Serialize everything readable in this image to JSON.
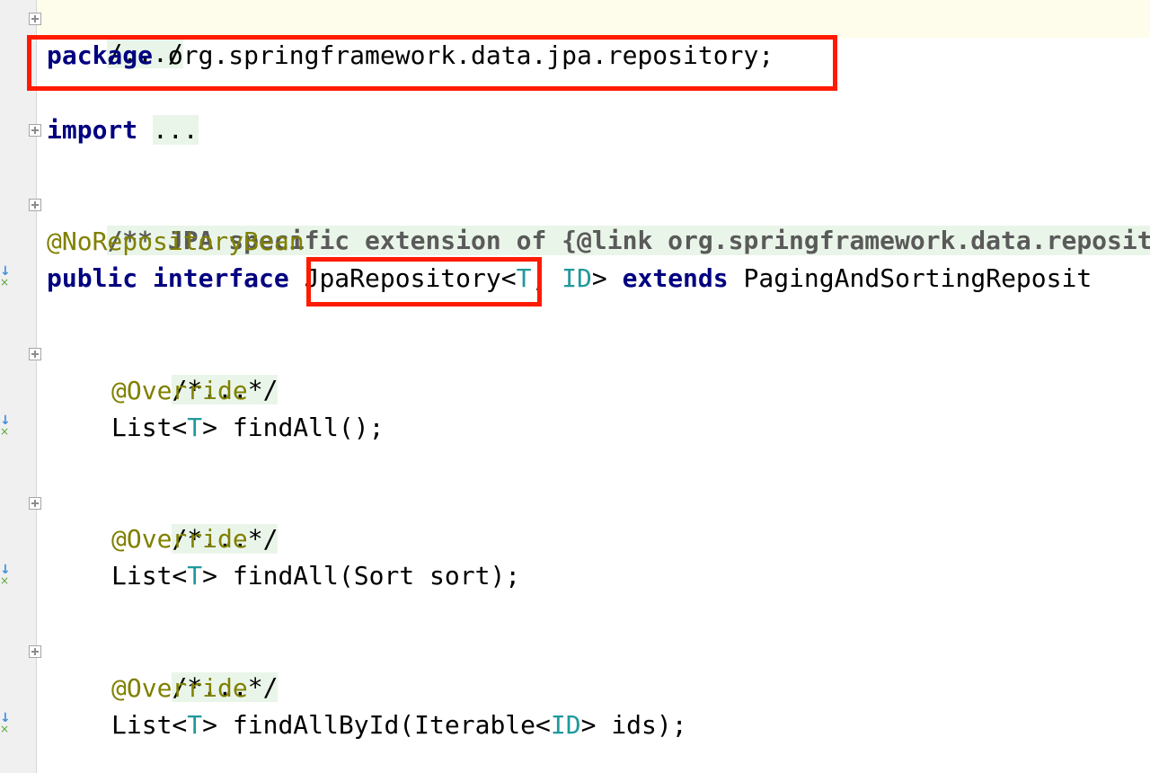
{
  "editor": {
    "lines": [
      {
        "id": "fold-header",
        "text": "/.../"
      },
      {
        "id": "package",
        "keyword": "package",
        "rest": " org.springframework.data.jpa.repository;"
      },
      {
        "id": "import",
        "keyword": "import",
        "rest": "..."
      },
      {
        "id": "javadoc",
        "text": "/** JPA specific extension of {@link org.springframework.data.reposit"
      },
      {
        "id": "annotation",
        "text": "@NoRepositoryBean"
      },
      {
        "id": "decl",
        "kw1": "public",
        "kw2": "interface",
        "name": "JpaRepository",
        "t": "T",
        "id_type": "ID",
        "ext": "extends",
        "parent": "PagingAndSortingReposit"
      },
      {
        "id": "m1-doc",
        "text": "/*...*/"
      },
      {
        "id": "m1-ann",
        "text": "@Override"
      },
      {
        "id": "m1-sig",
        "pre": "List<",
        "t": "T",
        "post": "> findAll();"
      },
      {
        "id": "m2-doc",
        "text": "/*...*/"
      },
      {
        "id": "m2-ann",
        "text": "@Override"
      },
      {
        "id": "m2-sig",
        "pre": "List<",
        "t": "T",
        "post": "> findAll(Sort sort);"
      },
      {
        "id": "m3-doc",
        "text": "/*...*/"
      },
      {
        "id": "m3-ann",
        "text": "@Override"
      },
      {
        "id": "m3-sig",
        "pre": "List<",
        "t": "T",
        "mid": "> findAllById(Iterable<",
        "id_type": "ID",
        "post": "> ids);"
      }
    ]
  },
  "icons": {
    "fold": "fold-expand-icon",
    "implemented": "implemented-arrow-icon"
  },
  "colors": {
    "highlight": "#ff1a00",
    "keyword": "#000080",
    "annotation": "#808000",
    "type_param": "#20999d"
  }
}
